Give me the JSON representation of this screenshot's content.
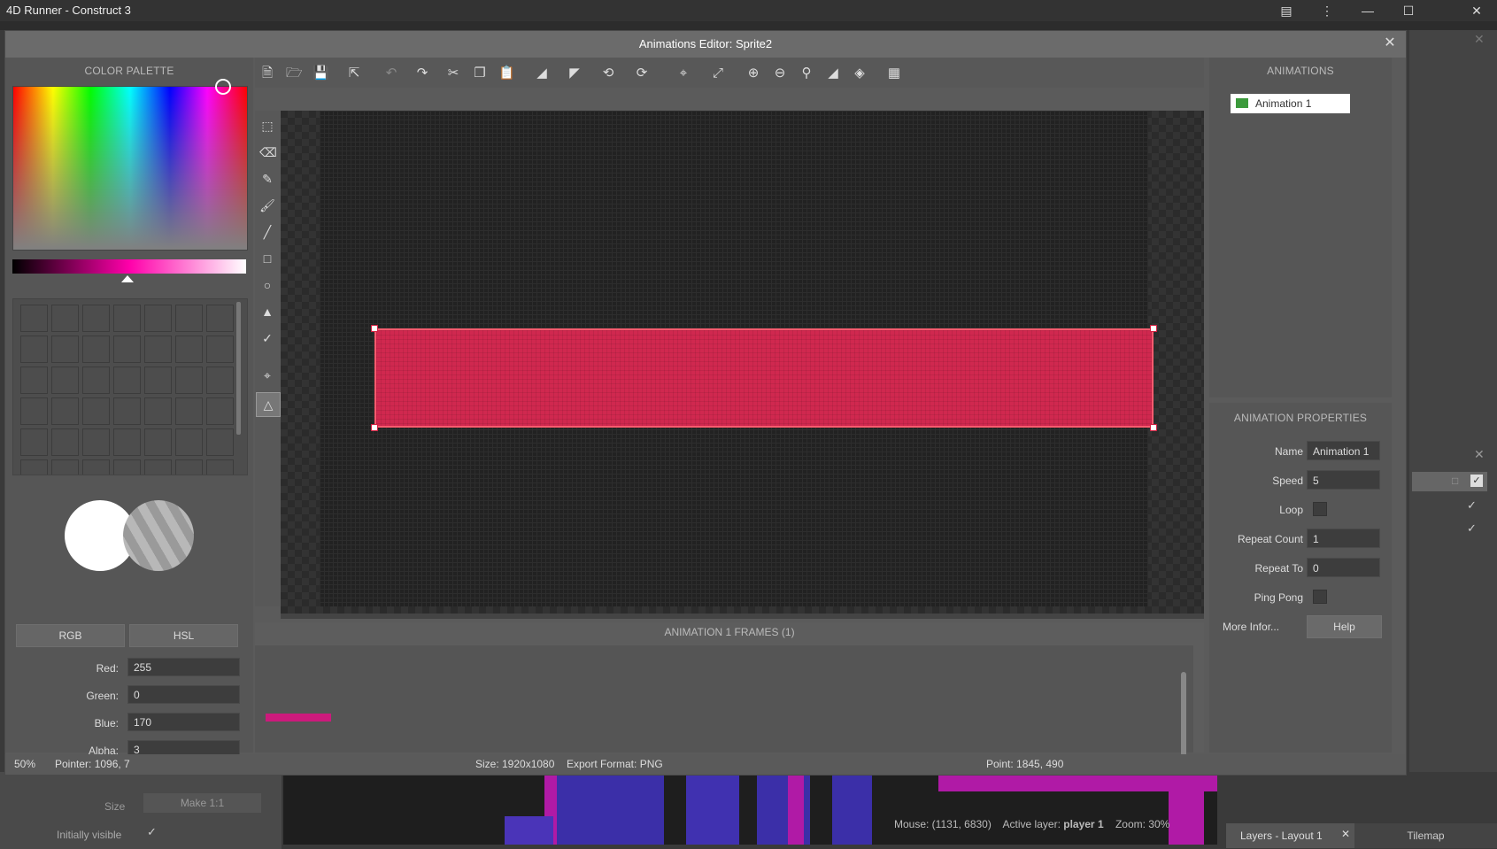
{
  "app": {
    "title": "4D Runner - Construct 3"
  },
  "dialog": {
    "title": "Animations Editor: Sprite2"
  },
  "palette": {
    "heading": "COLOR PALETTE",
    "modes": [
      "RGB",
      "HSL"
    ],
    "fields": {
      "red_label": "Red:",
      "red": "255",
      "green_label": "Green:",
      "green": "0",
      "blue_label": "Blue:",
      "blue": "170",
      "alpha_label": "Alpha:",
      "alpha": "3"
    },
    "primary_color": "#ffffff",
    "hue_color": "#ff00aa"
  },
  "toolbar": {
    "icons": [
      "new-icon",
      "open-icon",
      "save-icon",
      "export-icon",
      "undo-icon",
      "redo-icon",
      "cut-icon",
      "copy-icon",
      "paste-icon",
      "mirror-icon",
      "flip-icon",
      "rotate-ccw-icon",
      "rotate-cw-icon",
      "crop-icon",
      "resize-icon",
      "zoom-in-icon",
      "zoom-out-icon",
      "zoom-reset-icon",
      "background-toggle-icon",
      "layers-icon",
      "grid-icon"
    ]
  },
  "tools": [
    "select-icon",
    "eraser-icon",
    "pencil-icon",
    "brush-icon",
    "line-icon",
    "rectangle-icon",
    "ellipse-icon",
    "fill-icon",
    "eyedropper-icon",
    "origin-icon",
    "polygon-icon"
  ],
  "frames": {
    "heading": "ANIMATION 1 FRAMES (1)",
    "frame_index": "0",
    "frame_color": "#cc1a7c"
  },
  "animations": {
    "heading": "ANIMATIONS",
    "items": [
      "Animation 1"
    ]
  },
  "properties": {
    "heading": "ANIMATION PROPERTIES",
    "name_label": "Name",
    "name": "Animation 1",
    "speed_label": "Speed",
    "speed": "5",
    "loop_label": "Loop",
    "repeat_count_label": "Repeat Count",
    "repeat_count": "1",
    "repeat_to_label": "Repeat To",
    "repeat_to": "0",
    "ping_pong_label": "Ping Pong",
    "more_info_label": "More Infor...",
    "help": "Help"
  },
  "status": {
    "zoom": "50%",
    "pointer": "Pointer: 1096, 7",
    "size": "Size: 1920x1080",
    "export_format": "Export Format: PNG",
    "point": "Point: 1845, 490"
  },
  "background": {
    "size_label": "Size",
    "make_button": "Make 1:1",
    "initially_visible": "Initially visible",
    "mouse": "Mouse: (1131, 6830)",
    "active_layer_label": "Active layer:",
    "active_layer": "player 1",
    "zoom": "Zoom: 30%",
    "layers_tab": "Layers - Layout 1",
    "tilemap_tab": "Tilemap"
  },
  "sprite": {
    "fill_color": "#d0284f"
  }
}
